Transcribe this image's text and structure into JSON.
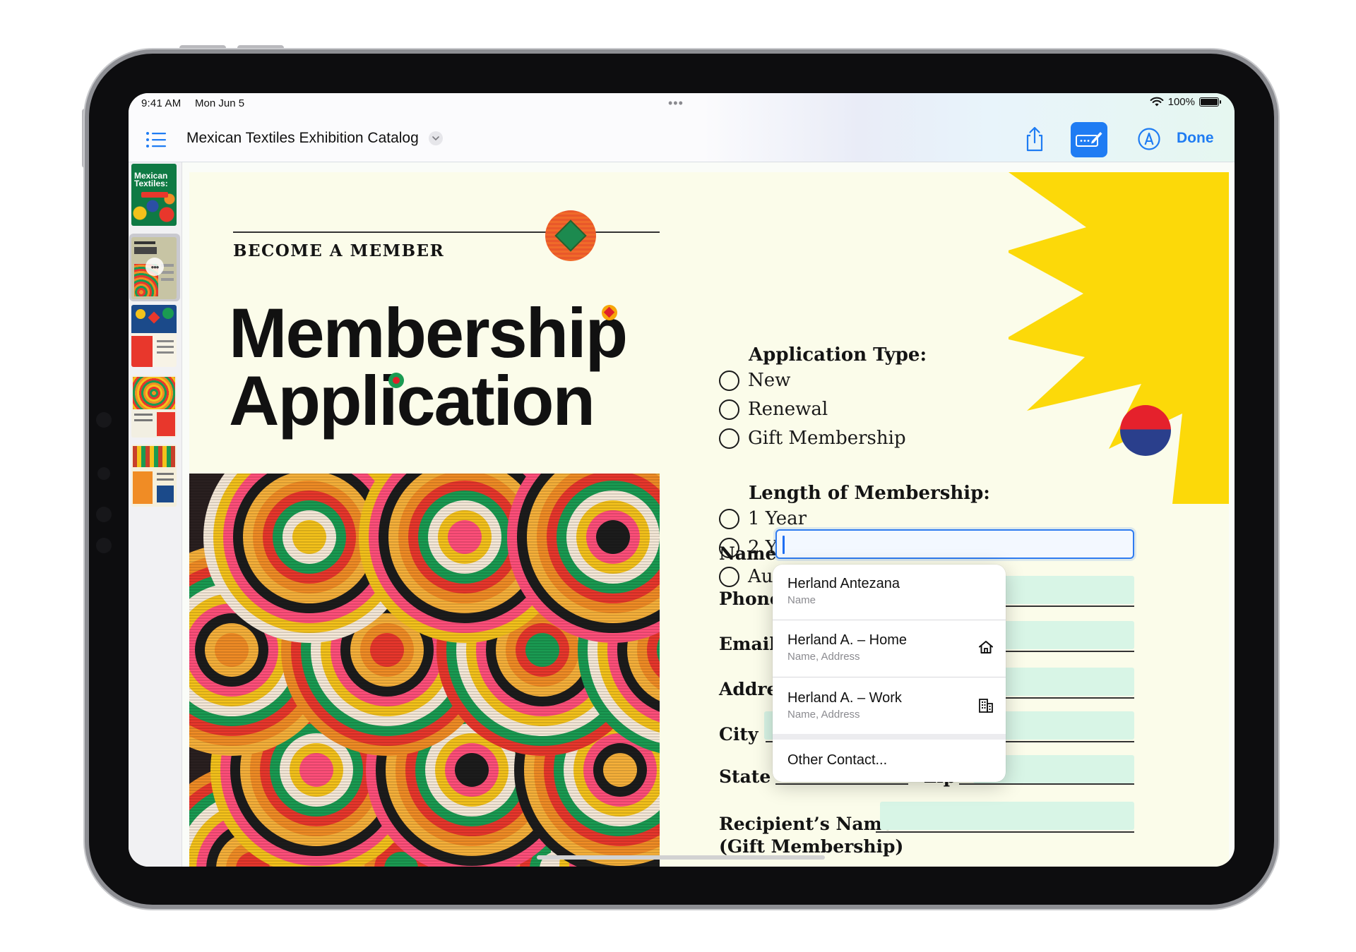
{
  "status_bar": {
    "time": "9:41 AM",
    "date": "Mon Jun 5",
    "more": "•••",
    "battery": "100%"
  },
  "nav": {
    "title": "Mexican Textiles Exhibition Catalog",
    "done_label": "Done",
    "icons": {
      "list": "list-icon",
      "chevron": "chevron-down-icon",
      "share": "share-icon",
      "forms": "form-fill-icon",
      "markup": "markup-pen-icon"
    },
    "accent": "#1f7cf3"
  },
  "thumbnails": {
    "cover_text": "Mexican Textiles:",
    "more": "•••",
    "selected_index": 1,
    "count": 5
  },
  "document": {
    "kicker": "BECOME A MEMBER",
    "title_line1": "Membership",
    "title_line2": "Application",
    "application_type": {
      "heading": "Application Type:",
      "options": [
        "New",
        "Renewal",
        "Gift Membership"
      ]
    },
    "length": {
      "heading": "Length of Membership:",
      "options": [
        "1 Year",
        "2 Years",
        "Auto-renewal"
      ]
    },
    "fields": {
      "name": "Name",
      "phone": "Phone",
      "email": "Email",
      "address": "Address",
      "city": "City",
      "state": "State",
      "zip": "Zip",
      "recipient_line1": "Recipient’s Name",
      "recipient_line2": "(Gift Membership)"
    },
    "field_fill_color": "#d8f5e6",
    "page_color": "#fbfcea",
    "sun_color": "#fcd909"
  },
  "autofill": {
    "items": [
      {
        "title": "Herland Antezana",
        "subtitle": "Name",
        "icon": ""
      },
      {
        "title": "Herland A. – Home",
        "subtitle": "Name, Address",
        "icon": "house-icon"
      },
      {
        "title": "Herland A. – Work",
        "subtitle": "Name, Address",
        "icon": "building-icon"
      }
    ],
    "other": "Other Contact..."
  }
}
